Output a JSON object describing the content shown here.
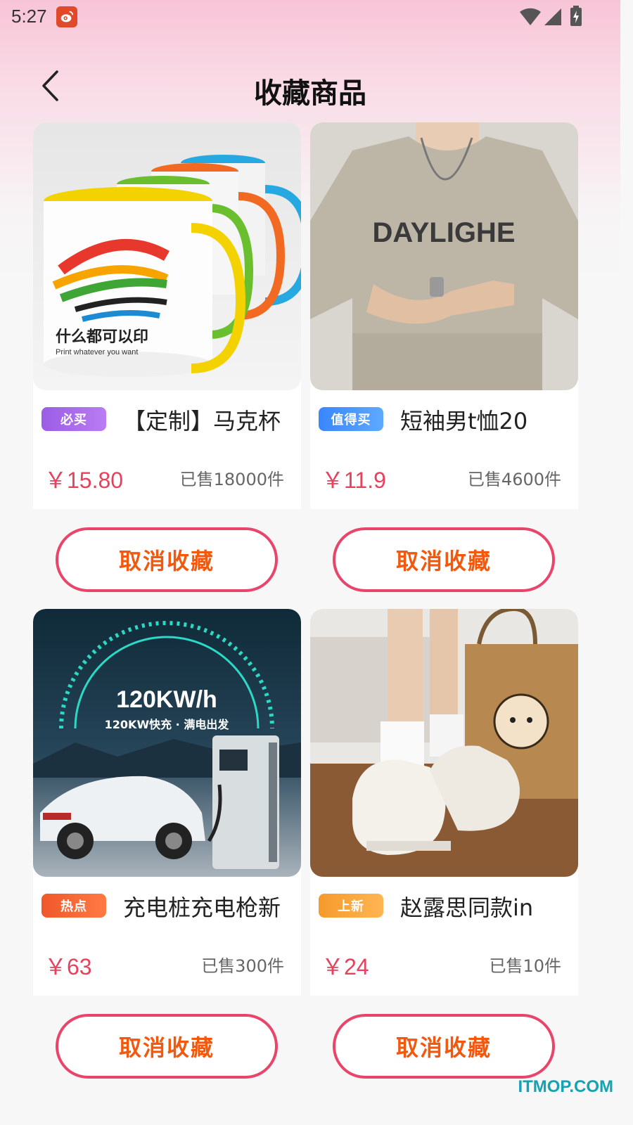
{
  "status_bar": {
    "time": "5:27"
  },
  "header": {
    "title": "收藏商品"
  },
  "products": [
    {
      "tag": "必买",
      "tag_color": "#9b5de5",
      "title": "【定制】马克杯",
      "price": "￥15.80",
      "sold": "已售18000件",
      "action": "取消收藏"
    },
    {
      "tag": "值得买",
      "tag_color": "#3a86ff",
      "title": "短袖男t恤20",
      "price": "￥11.9",
      "sold": "已售4600件",
      "action": "取消收藏"
    },
    {
      "tag": "热点",
      "tag_color": "#f0582b",
      "title": "充电桩充电枪新",
      "price": "￥63",
      "sold": "已售300件",
      "action": "取消收藏"
    },
    {
      "tag": "上新",
      "tag_color": "#f59a2c",
      "title": "赵露思同款in",
      "price": "￥24",
      "sold": "已售10件",
      "action": "取消收藏"
    }
  ],
  "images": {
    "mug_caption": "什么都可以印",
    "mug_caption_en": "Print whatever you want",
    "tshirt_print": "DAYLIGHE",
    "charger_headline": "120KW/h",
    "charger_subline": "120KW快充 · 满电出发"
  },
  "watermark": "ITMOP.COM"
}
